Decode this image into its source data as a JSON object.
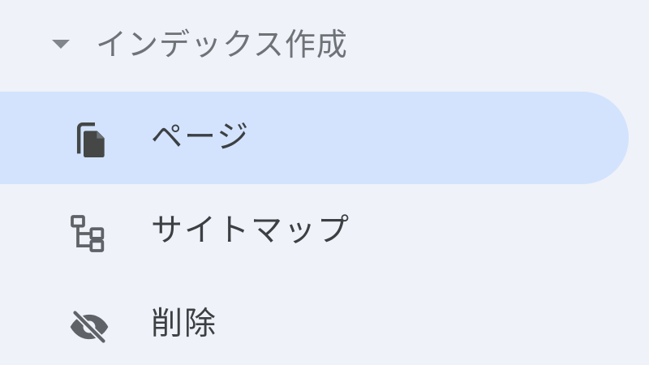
{
  "section": {
    "label": "インデックス作成",
    "expanded": true,
    "caret_icon": "caret-down-icon"
  },
  "items": [
    {
      "label": "ページ",
      "icon": "pages-icon",
      "active": true
    },
    {
      "label": "サイトマップ",
      "icon": "sitemap-icon",
      "active": false
    },
    {
      "label": "削除",
      "icon": "eye-off-icon",
      "active": false
    }
  ],
  "colors": {
    "background": "#eff2f8",
    "active_background": "#d3e3fd",
    "text": "#3c4043",
    "header_text": "#6e7378",
    "icon": "#444746"
  }
}
